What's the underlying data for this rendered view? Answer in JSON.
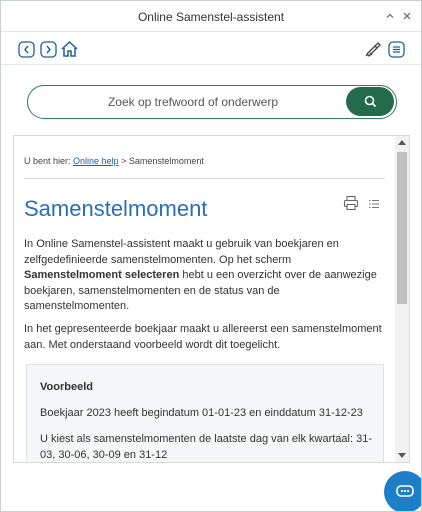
{
  "window": {
    "title": "Online Samenstel-assistent"
  },
  "toolbar": {
    "back_icon": "chevron-left-icon",
    "forward_icon": "chevron-right-icon",
    "home_icon": "home-icon",
    "announce_icon": "megaphone-icon",
    "menu_icon": "menu-icon"
  },
  "search": {
    "placeholder": "Zoek op trefwoord of onderwerp",
    "button_icon": "search-icon"
  },
  "breadcrumb": {
    "prefix": "U bent hier:",
    "link": "Online help",
    "separator": ">",
    "current": "Samenstelmoment"
  },
  "article": {
    "title": "Samenstelmoment",
    "p1_a": "In Online Samenstel-assistent maakt u gebruik van boekjaren en zelfgedefinieerde samenstelmomenten. Op het scherm ",
    "p1_bold": "Samenstelmoment selecteren",
    "p1_b": " hebt u een overzicht over de aanwezige boekjaren, samenstelmomenten en de status van de samenstelmomenten.",
    "p2": "In het gepresenteerde boekjaar maakt u allereerst een samenstelmoment aan. Met onderstaand voorbeeld wordt dit toegelicht.",
    "example": {
      "title": "Voorbeeld",
      "line1": "Boekjaar 2023 heeft begindatum 01-01-23 en einddatum 31-12-23",
      "line2": "U kiest als samenstelmomenten de laatste dag van elk kwartaal: 31-03, 30-06, 30-09 en 31-12"
    }
  },
  "colors": {
    "accent_green": "#236b4b",
    "title_blue": "#2a6db5",
    "link_blue": "#1a5fa8",
    "chat_blue": "#1d7fc8"
  }
}
